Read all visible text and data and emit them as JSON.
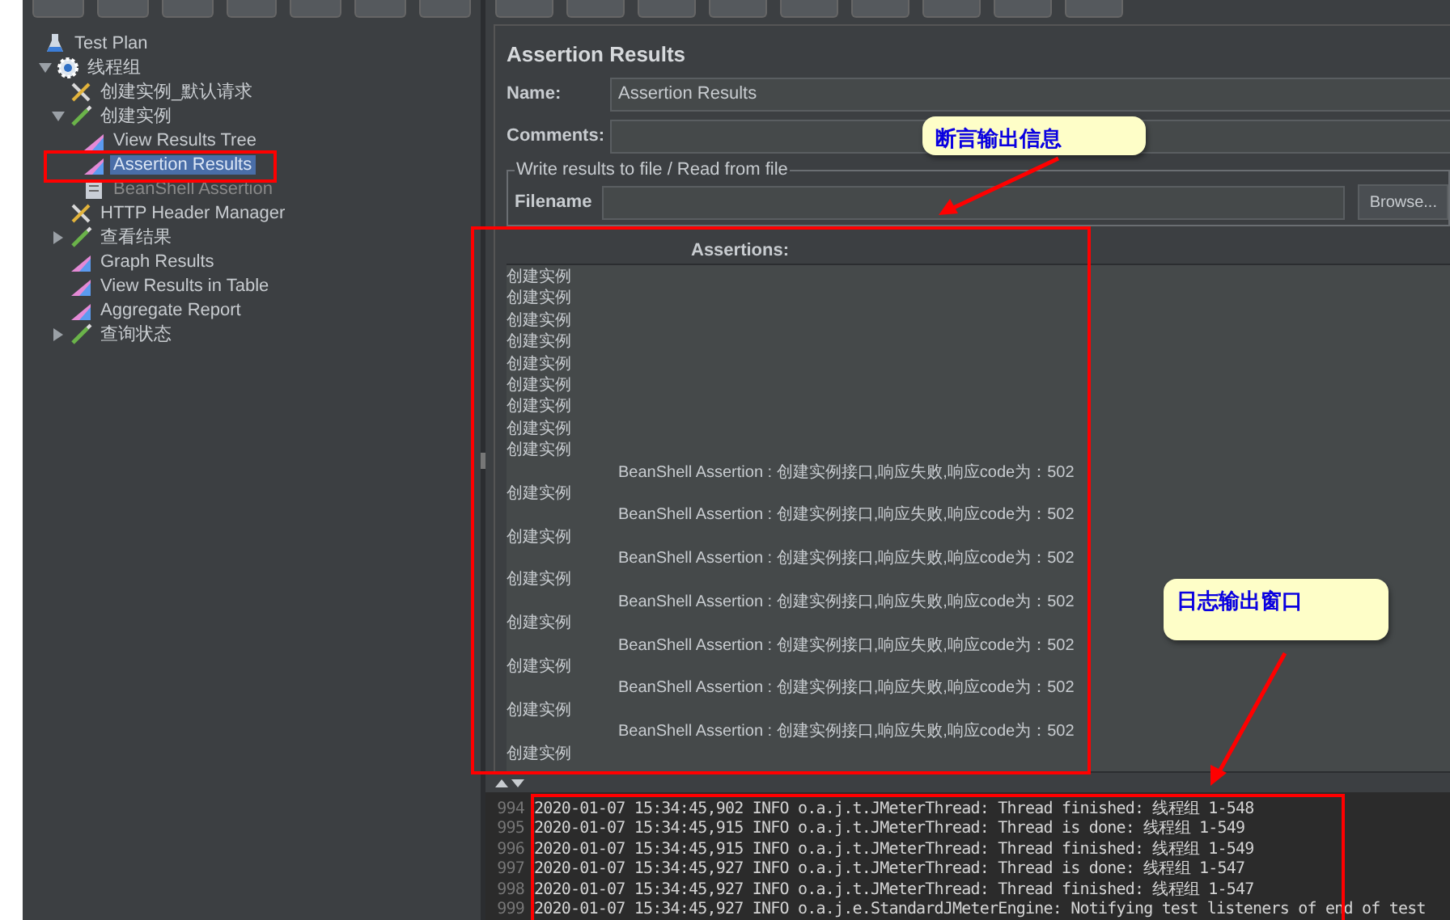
{
  "tree": [
    {
      "label": "Test Plan",
      "kind": "flask",
      "selected": false,
      "children": [
        {
          "label": "线程组",
          "kind": "gear",
          "expanded": true,
          "selected": false,
          "children": [
            {
              "label": "创建实例_默认请求",
              "kind": "tools",
              "selected": false
            },
            {
              "label": "创建实例",
              "kind": "sampler",
              "expanded": true,
              "selected": false,
              "children": [
                {
                  "label": "View Results Tree",
                  "kind": "chart",
                  "selected": false
                },
                {
                  "label": "Assertion Results",
                  "kind": "chart",
                  "selected": true
                },
                {
                  "label": "BeanShell Assertion",
                  "kind": "script",
                  "selected": false
                }
              ]
            },
            {
              "label": "HTTP Header Manager",
              "kind": "tools",
              "selected": false
            },
            {
              "label": "查看结果",
              "kind": "sampler",
              "expanded": false,
              "selected": false
            },
            {
              "label": "Graph Results",
              "kind": "chart",
              "selected": false
            },
            {
              "label": "View Results in Table",
              "kind": "chart",
              "selected": false
            },
            {
              "label": "Aggregate Report",
              "kind": "chart",
              "selected": false
            },
            {
              "label": "查询状态",
              "kind": "sampler",
              "expanded": false,
              "selected": false
            }
          ]
        }
      ]
    }
  ],
  "panel": {
    "title": "Assertion Results",
    "name_label": "Name:",
    "name_value": "Assertion Results",
    "comments_label": "Comments:",
    "file_group": "Write results to file / Read from file",
    "filename_label": "Filename",
    "browse_button": "Browse...",
    "assertions_header": "Assertions:",
    "assertions": [
      {
        "kind": "sample",
        "text": "创建实例"
      },
      {
        "kind": "sample",
        "text": "创建实例"
      },
      {
        "kind": "sample",
        "text": "创建实例"
      },
      {
        "kind": "sample",
        "text": "创建实例"
      },
      {
        "kind": "sample",
        "text": "创建实例"
      },
      {
        "kind": "sample",
        "text": "创建实例"
      },
      {
        "kind": "sample",
        "text": "创建实例"
      },
      {
        "kind": "sample",
        "text": "创建实例"
      },
      {
        "kind": "sample",
        "text": "创建实例"
      },
      {
        "kind": "failure",
        "text": "BeanShell Assertion : 创建实例接口,响应失败,响应code为：502"
      },
      {
        "kind": "sample",
        "text": "创建实例"
      },
      {
        "kind": "failure",
        "text": "BeanShell Assertion : 创建实例接口,响应失败,响应code为：502"
      },
      {
        "kind": "sample",
        "text": "创建实例"
      },
      {
        "kind": "failure",
        "text": "BeanShell Assertion : 创建实例接口,响应失败,响应code为：502"
      },
      {
        "kind": "sample",
        "text": "创建实例"
      },
      {
        "kind": "failure",
        "text": "BeanShell Assertion : 创建实例接口,响应失败,响应code为：502"
      },
      {
        "kind": "sample",
        "text": "创建实例"
      },
      {
        "kind": "failure",
        "text": "BeanShell Assertion : 创建实例接口,响应失败,响应code为：502"
      },
      {
        "kind": "sample",
        "text": "创建实例"
      },
      {
        "kind": "failure",
        "text": "BeanShell Assertion : 创建实例接口,响应失败,响应code为：502"
      },
      {
        "kind": "sample",
        "text": "创建实例"
      },
      {
        "kind": "failure",
        "text": "BeanShell Assertion : 创建实例接口,响应失败,响应code为：502"
      },
      {
        "kind": "sample",
        "text": "创建实例"
      }
    ]
  },
  "log": [
    {
      "line": "994",
      "text": "2020-01-07 15:34:45,902 INFO o.a.j.t.JMeterThread: Thread finished: 线程组 1-548"
    },
    {
      "line": "995",
      "text": "2020-01-07 15:34:45,915 INFO o.a.j.t.JMeterThread: Thread is done: 线程组 1-549"
    },
    {
      "line": "996",
      "text": "2020-01-07 15:34:45,915 INFO o.a.j.t.JMeterThread: Thread finished: 线程组 1-549"
    },
    {
      "line": "997",
      "text": "2020-01-07 15:34:45,927 INFO o.a.j.t.JMeterThread: Thread is done: 线程组 1-547"
    },
    {
      "line": "998",
      "text": "2020-01-07 15:34:45,927 INFO o.a.j.t.JMeterThread: Thread finished: 线程组 1-547"
    },
    {
      "line": "999",
      "text": "2020-01-07 15:34:45,927 INFO o.a.j.e.StandardJMeterEngine: Notifying test listeners of end of test"
    }
  ],
  "annotations": [
    {
      "text": "断言输出信息"
    },
    {
      "text": "日志输出窗口"
    }
  ]
}
